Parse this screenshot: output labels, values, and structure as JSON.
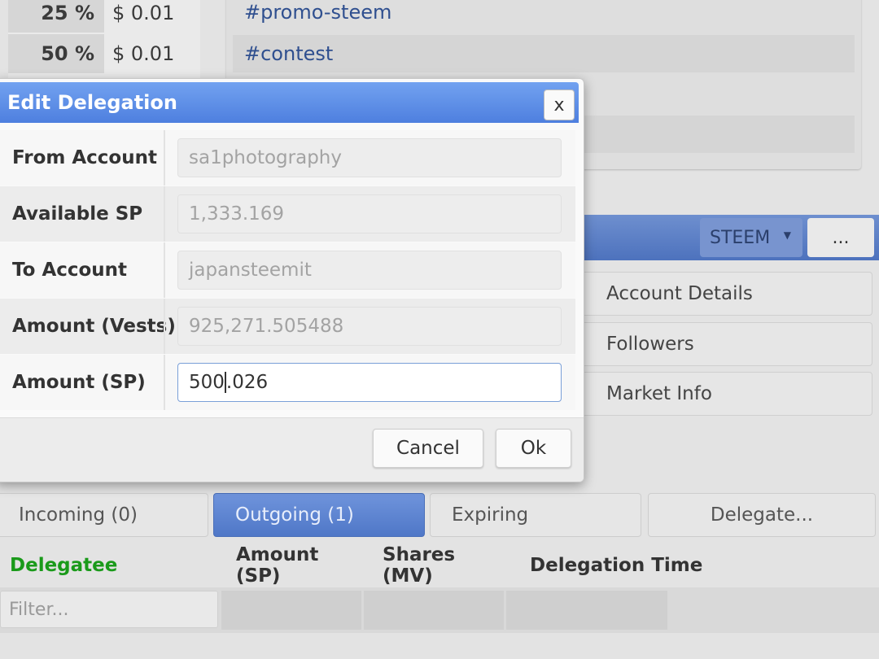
{
  "vote_rows": [
    {
      "percent": "25 %",
      "value": "$ 0.01"
    },
    {
      "percent": "50 %",
      "value": "$ 0.01"
    }
  ],
  "tags": [
    "#promo-steem",
    "#contest"
  ],
  "toolbar": {
    "currency": "STEEM",
    "more": "..."
  },
  "account_menu": [
    "Account Details",
    "Followers",
    "Market Info"
  ],
  "tabs": [
    "Incoming (0)",
    "Outgoing (1)",
    "Expiring",
    "Delegate..."
  ],
  "active_tab": "Outgoing (1)",
  "table": {
    "columns": [
      "Delegatee",
      "Amount (SP)",
      "Shares (MV)",
      "Delegation Time"
    ],
    "filter_placeholder": "Filter..."
  },
  "dialog": {
    "title": "Edit Delegation",
    "close": "x",
    "fields": [
      {
        "label": "From Account",
        "value": "sa1photography"
      },
      {
        "label": "Available SP",
        "value": "1,333.169"
      },
      {
        "label": "To Account",
        "value": "japansteemit"
      },
      {
        "label": "Amount (Vests)",
        "value": "925,271.505488"
      },
      {
        "label": "Amount (SP)",
        "value_before_cursor": "500",
        "value_after_cursor": ".026"
      }
    ],
    "cancel": "Cancel",
    "ok": "Ok"
  },
  "colors": {
    "accent_blue": "#4e7fdf",
    "delegatee_header": "#1a9a1a",
    "tag_link": "#2f4f8f"
  }
}
